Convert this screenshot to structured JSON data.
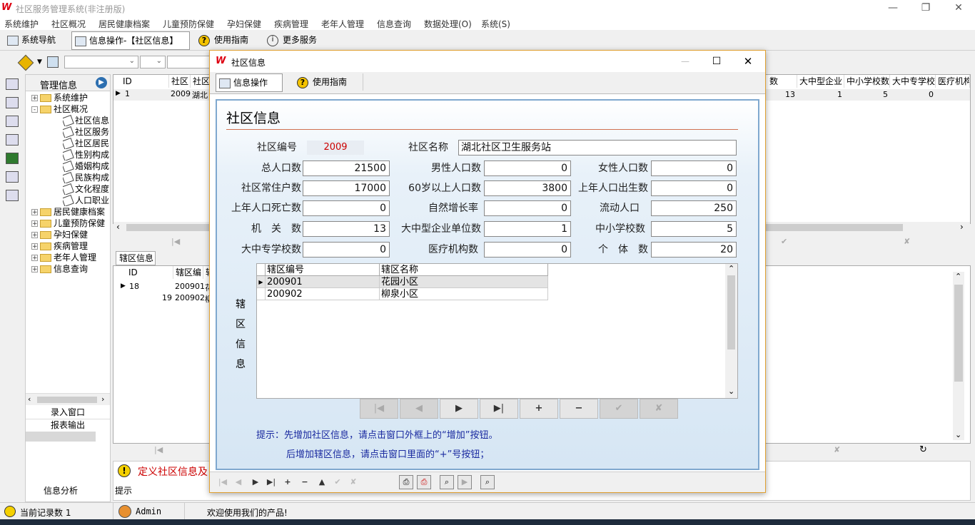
{
  "app": {
    "title": "社区服务管理系统(非注册版)"
  },
  "menu": [
    "系统维护",
    "社区概况",
    "居民健康档案",
    "儿童预防保健",
    "孕妇保健",
    "疾病管理",
    "老年人管理",
    "信息查询",
    "数据处理(O)",
    "系统(S)"
  ],
  "main_tabs": {
    "nav": "系统导航",
    "info_op": "信息操作-【社区信息】",
    "guide": "使用指南",
    "more": "更多服务"
  },
  "tree": {
    "header": "管理信息",
    "nodes": [
      {
        "label": "系统维护",
        "level": 0,
        "kind": "folder",
        "exp": "+"
      },
      {
        "label": "社区概况",
        "level": 0,
        "kind": "folder",
        "exp": "-"
      },
      {
        "label": "社区信息",
        "level": 1,
        "kind": "leaf"
      },
      {
        "label": "社区服务",
        "level": 1,
        "kind": "leaf"
      },
      {
        "label": "社区居民",
        "level": 1,
        "kind": "leaf"
      },
      {
        "label": "性别构成",
        "level": 1,
        "kind": "leaf"
      },
      {
        "label": "婚姻构成",
        "level": 1,
        "kind": "leaf"
      },
      {
        "label": "民族构成",
        "level": 1,
        "kind": "leaf"
      },
      {
        "label": "文化程度",
        "level": 1,
        "kind": "leaf"
      },
      {
        "label": "人口职业",
        "level": 1,
        "kind": "leaf"
      },
      {
        "label": "居民健康档案",
        "level": 0,
        "kind": "folder",
        "exp": "+"
      },
      {
        "label": "儿童预防保健",
        "level": 0,
        "kind": "folder",
        "exp": "+"
      },
      {
        "label": "孕妇保健",
        "level": 0,
        "kind": "folder",
        "exp": "+"
      },
      {
        "label": "疾病管理",
        "level": 0,
        "kind": "folder",
        "exp": "+"
      },
      {
        "label": "老年人管理",
        "level": 0,
        "kind": "folder",
        "exp": "+"
      },
      {
        "label": "信息查询",
        "level": 0,
        "kind": "folder",
        "exp": "+"
      }
    ],
    "btn_entry": "录入窗口",
    "btn_report": "报表输出",
    "btn_analysis": "信息分析"
  },
  "bg_grid": {
    "headers_left": [
      "ID",
      "社区",
      "社区-"
    ],
    "row_left": [
      "1",
      "2009",
      "湖北"
    ],
    "headers_right": [
      "数",
      "大中型企业",
      "中小学校数",
      "大中专学校",
      "医疗机构"
    ],
    "row_right": [
      "13",
      "1",
      "5",
      "0",
      ""
    ]
  },
  "bg_sub": {
    "tab": "辖区信息",
    "headers": [
      "ID",
      "辖区编",
      "辖"
    ],
    "rows": [
      [
        "18",
        "200901",
        "花"
      ],
      [
        "19",
        "200902",
        "柳"
      ]
    ]
  },
  "hint_bar": {
    "text": "定义社区信息及",
    "label": "提示"
  },
  "status": {
    "records": "当前记录数 1",
    "user": "Admin",
    "welcome": "欢迎使用我们的产品!"
  },
  "dialog": {
    "title": "社区信息",
    "tab_op": "信息操作",
    "tab_guide": "使用指南",
    "heading": "社区信息",
    "fields": {
      "code_label": "社区编号",
      "code": "2009",
      "name_label": "社区名称",
      "name": "湖北社区卫生服务站",
      "total_label": "总人口数",
      "total": "21500",
      "male_label": "男性人口数",
      "male": "0",
      "female_label": "女性人口数",
      "female": "0",
      "households_label": "社区常住户数",
      "households": "17000",
      "over60_label": "60岁以上人口数",
      "over60": "3800",
      "births_label": "上年人口出生数",
      "births": "0",
      "deaths_label": "上年人口死亡数",
      "deaths": "0",
      "growth_label": "自然增长率",
      "growth": "0",
      "floating_label": "流动人口",
      "floating": "250",
      "org_label": "机　关　数",
      "org": "13",
      "bigco_label": "大中型企业单位数",
      "bigco": "1",
      "school_label": "中小学校数",
      "school": "5",
      "college_label": "大中专学校数",
      "college": "0",
      "medical_label": "医疗机构数",
      "medical": "0",
      "individual_label": "个　体　数",
      "individual": "20"
    },
    "sub_label": [
      "辖",
      "区",
      "信",
      "息"
    ],
    "sub_grid": {
      "headers": [
        "辖区编号",
        "辖区名称"
      ],
      "rows": [
        [
          "200901",
          "花园小区"
        ],
        [
          "200902",
          "柳泉小区"
        ]
      ]
    },
    "nav_buttons": [
      "|◀",
      "◀",
      "▶",
      "▶|",
      "+",
      "−",
      "✔",
      "✘"
    ],
    "tip_line1": "提示：先增加社区信息，请点击窗口外框上的“增加”按钮。",
    "tip_line2": "后增加辖区信息，请点击窗口里面的“+”号按钮；"
  },
  "colors": {
    "accent": "#e0a030",
    "code_text": "#cc0000",
    "tip_text": "#1a2aa0",
    "panel_border": "#7fa8cf"
  }
}
